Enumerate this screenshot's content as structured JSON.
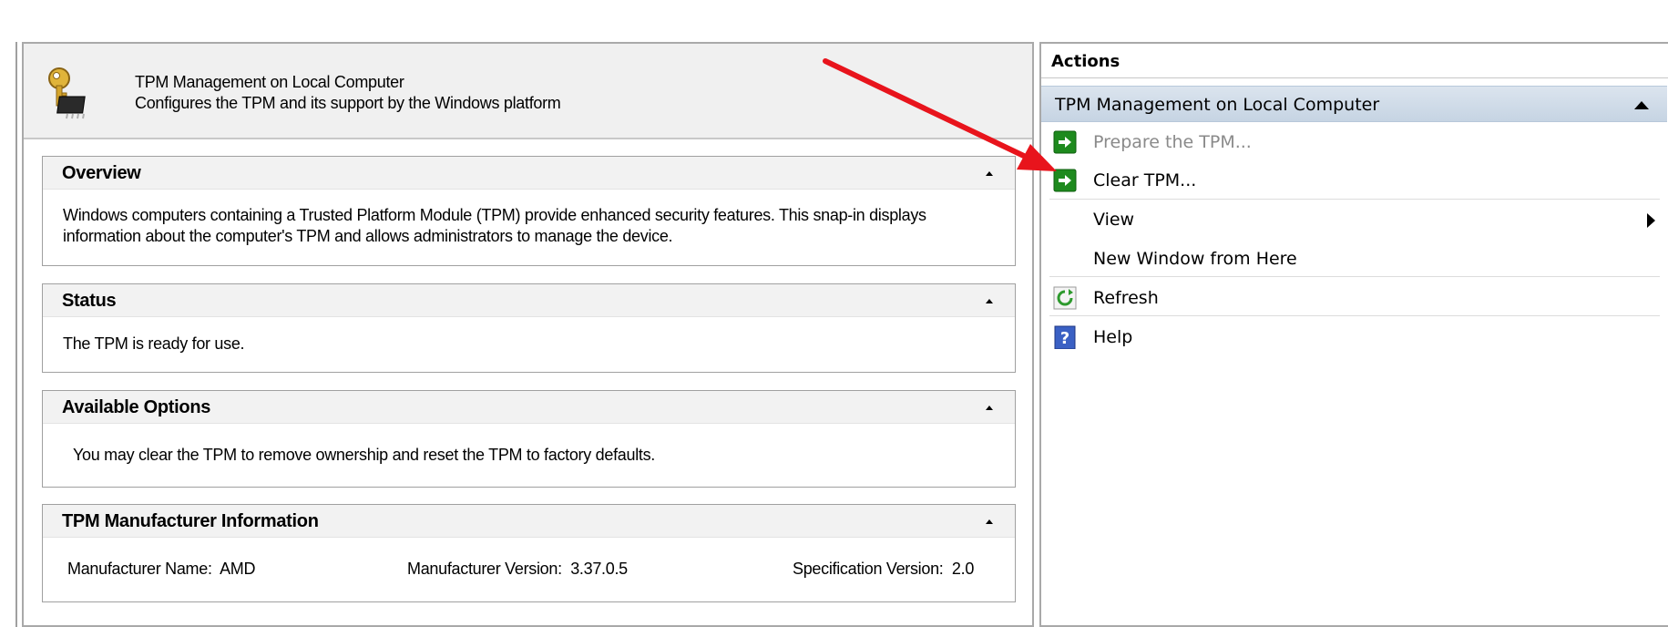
{
  "header": {
    "title": "TPM Management on Local Computer",
    "description": "Configures the TPM and its support by the Windows platform",
    "icon": "tpm-key-chip-icon"
  },
  "sections": {
    "overview": {
      "title": "Overview",
      "text": "Windows computers containing a Trusted Platform Module (TPM) provide enhanced security features. This snap-in displays information about the computer's TPM and allows administrators to manage the device."
    },
    "status": {
      "title": "Status",
      "text": "The TPM is ready for use."
    },
    "options": {
      "title": "Available Options",
      "text": "You may clear the TPM to remove ownership and reset the TPM to factory defaults."
    },
    "manufacturer": {
      "title": "TPM Manufacturer Information",
      "name_label": "Manufacturer Name:",
      "name_value": "AMD",
      "version_label": "Manufacturer Version:",
      "version_value": "3.37.0.5",
      "spec_label": "Specification Version:",
      "spec_value": "2.0"
    }
  },
  "actions": {
    "title": "Actions",
    "group_label": "TPM Management on Local Computer",
    "items": [
      {
        "label": "Prepare the TPM...",
        "icon": "run-action-icon",
        "enabled": false
      },
      {
        "label": "Clear TPM...",
        "icon": "run-action-icon",
        "enabled": true
      },
      {
        "label": "View",
        "icon": "",
        "enabled": true,
        "submenu": true
      },
      {
        "label": "New Window from Here",
        "icon": "",
        "enabled": true
      },
      {
        "label": "Refresh",
        "icon": "refresh-icon",
        "enabled": true
      },
      {
        "label": "Help",
        "icon": "help-icon",
        "enabled": true
      }
    ]
  },
  "colors": {
    "annotation_arrow": "#e8141c",
    "action_group_bg": "#c6d4e3",
    "run_icon": "#1e8a1e"
  }
}
